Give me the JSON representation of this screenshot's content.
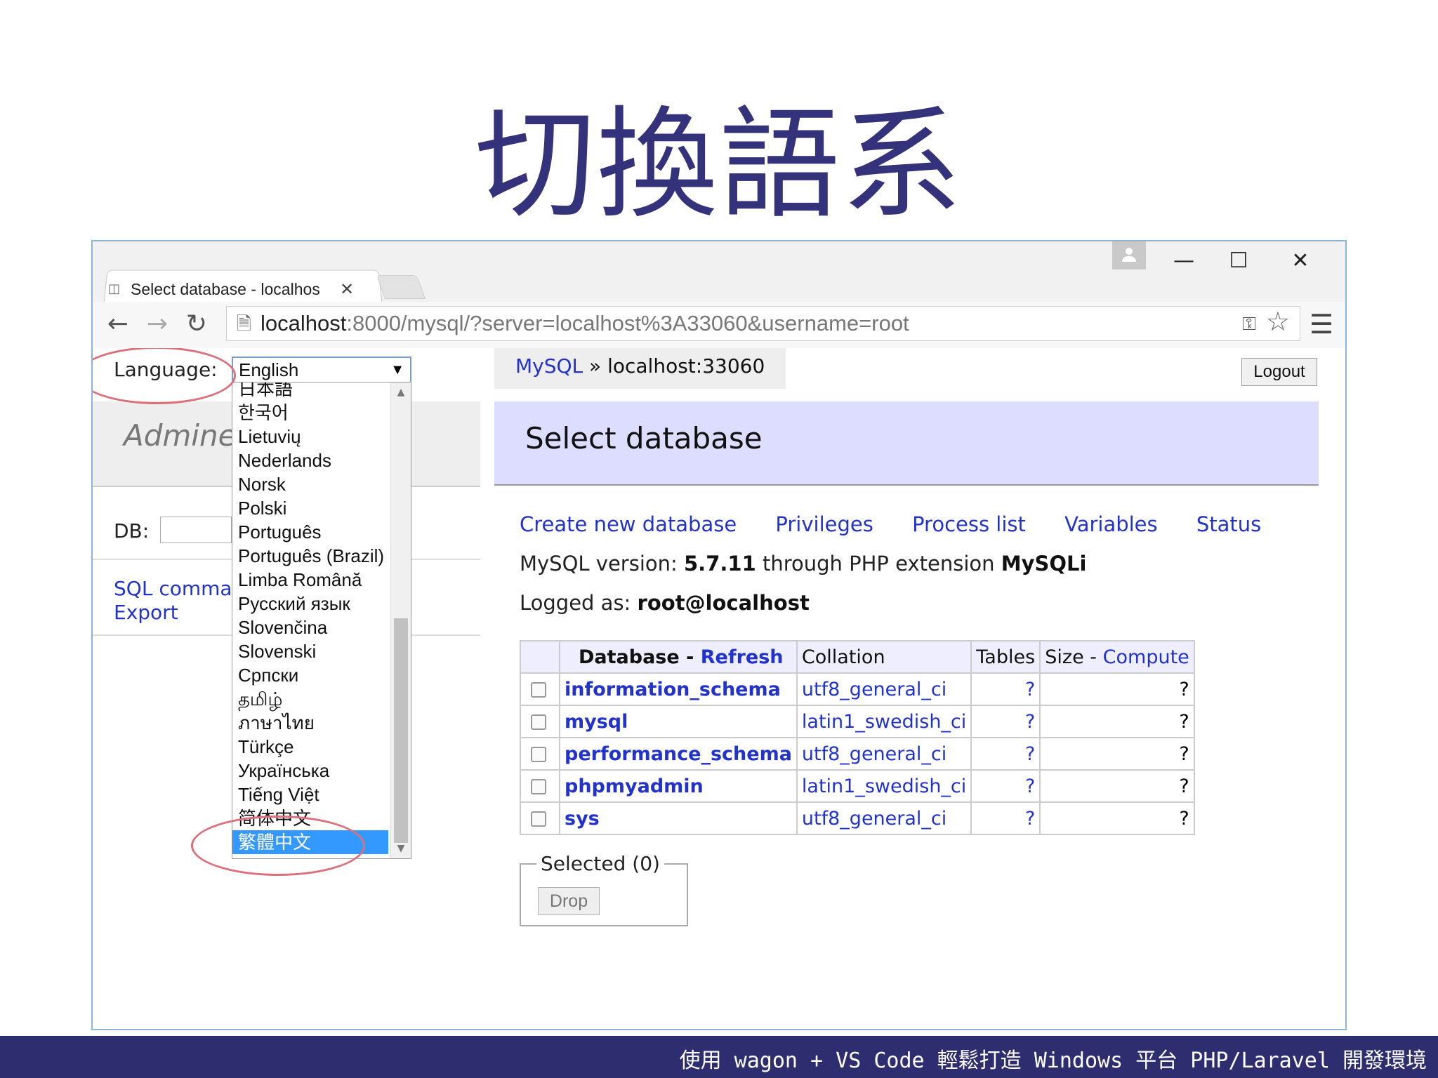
{
  "slide": {
    "title": "切換語系",
    "footer": "使用 wagon + VS Code 輕鬆打造 Windows 平台 PHP/Laravel 開發環境"
  },
  "browser": {
    "tab_title": "Select database - localhos",
    "address_host": "localhost",
    "address_path": ":8000/mysql/?server=localhost%3A33060&username=root",
    "icons": [
      "back-icon",
      "forward-icon",
      "reload-icon",
      "page-icon",
      "key-icon",
      "star-icon",
      "menu-icon",
      "profile-icon"
    ]
  },
  "sidebar": {
    "language_label": "Language:",
    "language_selected": "English",
    "languages": [
      "日本語",
      "한국어",
      "Lietuvių",
      "Nederlands",
      "Norsk",
      "Polski",
      "Português",
      "Português (Brazil)",
      "Limba Română",
      "Русский язык",
      "Slovenčina",
      "Slovenski",
      "Српски",
      "தமிழ்",
      "ภาษาไทย",
      "Türkçe",
      "Українська",
      "Tiếng Việt",
      "简体中文",
      "繁體中文"
    ],
    "highlighted_language": "繁體中文",
    "logo": "Adminer",
    "db_label": "DB:",
    "links": [
      "SQL command",
      "Export"
    ]
  },
  "main": {
    "breadcrumb_link": "MySQL",
    "breadcrumb_sep": " » ",
    "breadcrumb_current": "localhost:33060",
    "logout": "Logout",
    "heading": "Select database",
    "actions": [
      "Create new database",
      "Privileges",
      "Process list",
      "Variables",
      "Status"
    ],
    "version_prefix": "MySQL version: ",
    "version": "5.7.11",
    "version_mid": " through PHP extension ",
    "extension": "MySQLi",
    "logged_prefix": "Logged as: ",
    "logged_user": "root@localhost",
    "table": {
      "col_database": "Database",
      "col_sep": " - ",
      "col_refresh": "Refresh",
      "col_collation": "Collation",
      "col_tables": "Tables",
      "col_size": "Size",
      "col_compute": "Compute",
      "rows": [
        {
          "name": "information_schema",
          "collation": "utf8_general_ci",
          "tables": "?",
          "size": "?"
        },
        {
          "name": "mysql",
          "collation": "latin1_swedish_ci",
          "tables": "?",
          "size": "?"
        },
        {
          "name": "performance_schema",
          "collation": "utf8_general_ci",
          "tables": "?",
          "size": "?"
        },
        {
          "name": "phpmyadmin",
          "collation": "latin1_swedish_ci",
          "tables": "?",
          "size": "?"
        },
        {
          "name": "sys",
          "collation": "utf8_general_ci",
          "tables": "?",
          "size": "?"
        }
      ]
    },
    "selected_legend": "Selected (0)",
    "drop_button": "Drop"
  }
}
